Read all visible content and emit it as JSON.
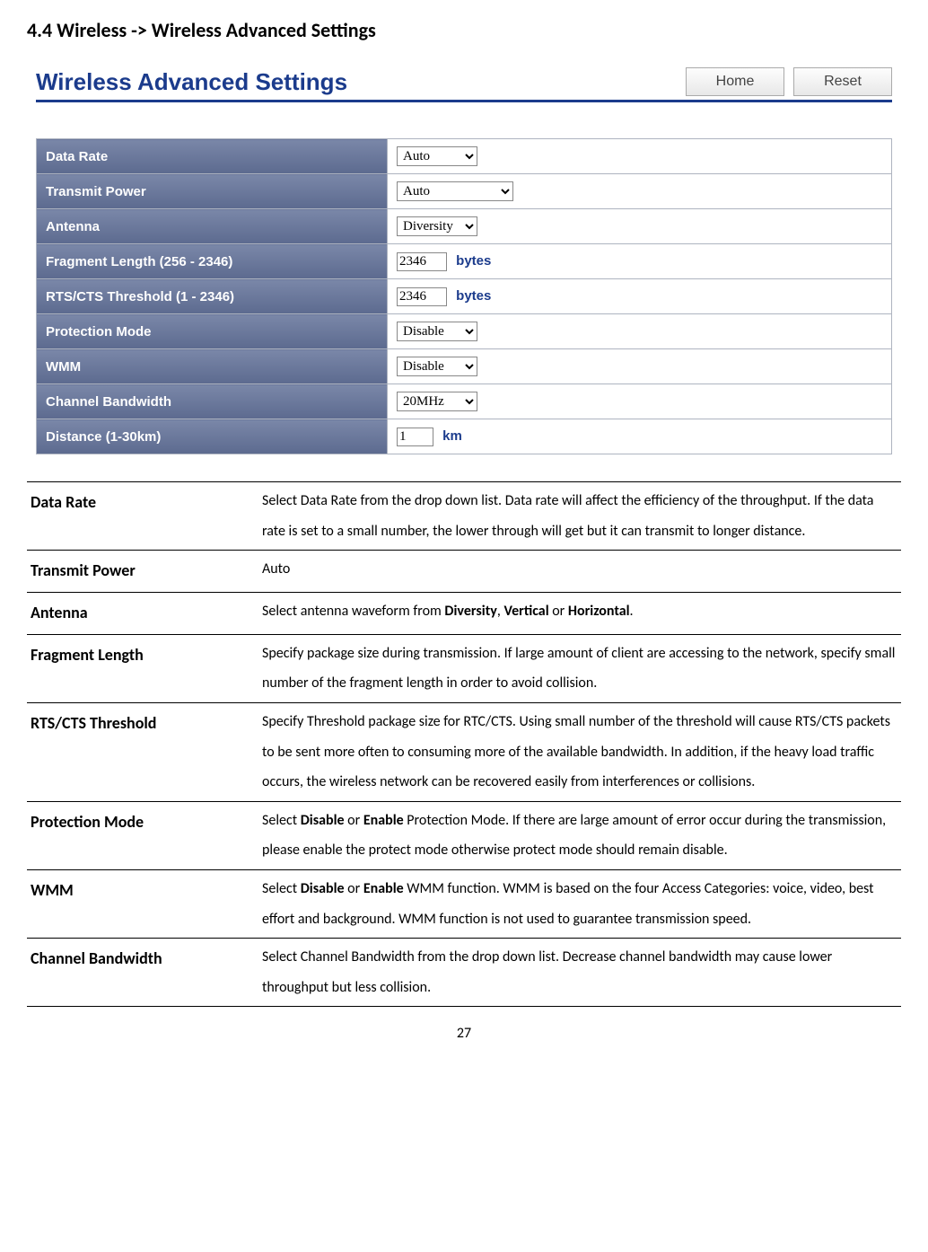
{
  "heading": "4.4 Wireless -> Wireless Advanced Settings",
  "panel": {
    "title": "Wireless Advanced Settings",
    "home_btn": "Home",
    "reset_btn": "Reset",
    "rows": {
      "data_rate": {
        "label": "Data Rate",
        "value": "Auto"
      },
      "transmit_power": {
        "label": "Transmit Power",
        "value": "Auto"
      },
      "antenna": {
        "label": "Antenna",
        "value": "Diversity"
      },
      "fragment": {
        "label": "Fragment Length (256 - 2346)",
        "value": "2346",
        "unit": "bytes"
      },
      "rtscts": {
        "label": "RTS/CTS Threshold (1 - 2346)",
        "value": "2346",
        "unit": "bytes"
      },
      "protection": {
        "label": "Protection Mode",
        "value": "Disable"
      },
      "wmm": {
        "label": "WMM",
        "value": "Disable"
      },
      "channel_bw": {
        "label": "Channel Bandwidth",
        "value": "20MHz"
      },
      "distance": {
        "label": "Distance (1-30km)",
        "value": "1",
        "unit": "km"
      }
    }
  },
  "descriptions": [
    {
      "term": "Data Rate",
      "desc": "Select Data Rate from the drop down list. Data rate will affect the efficiency of the throughput. If the data rate is set to a small number, the lower through will get but it can transmit to longer distance."
    },
    {
      "term": "Transmit Power",
      "desc": "Auto"
    },
    {
      "term": "Antenna",
      "desc_html": "Select antenna waveform from <b>Diversity</b>, <b>Vertical</b> or <b>Horizontal</b>."
    },
    {
      "term": "Fragment Length",
      "desc": "Specify package size during transmission. If large amount of client are accessing to the network, specify small number of the fragment length in order to avoid collision."
    },
    {
      "term": "RTS/CTS Threshold",
      "desc": "Specify Threshold package size for RTC/CTS. Using small number of the threshold will cause RTS/CTS packets to be sent more often to consuming more of the available bandwidth. In addition, if the heavy load traffic occurs, the wireless network can be recovered easily from interferences or collisions."
    },
    {
      "term": "Protection Mode",
      "desc_html": "Select <b>Disable</b> or <b>Enable</b> Protection Mode. If there are large amount of error occur during the transmission, please enable the protect mode otherwise protect mode should remain disable."
    },
    {
      "term": "WMM",
      "desc_html": "Select <b>Disable</b> or <b>Enable</b> WMM function. WMM is based on the four Access Categories: voice, video, best effort and background. WMM function is not used to guarantee transmission speed."
    },
    {
      "term": "Channel Bandwidth",
      "desc": "Select Channel Bandwidth from the drop down list. Decrease channel bandwidth may cause lower throughput but less collision."
    }
  ],
  "page_number": "27"
}
